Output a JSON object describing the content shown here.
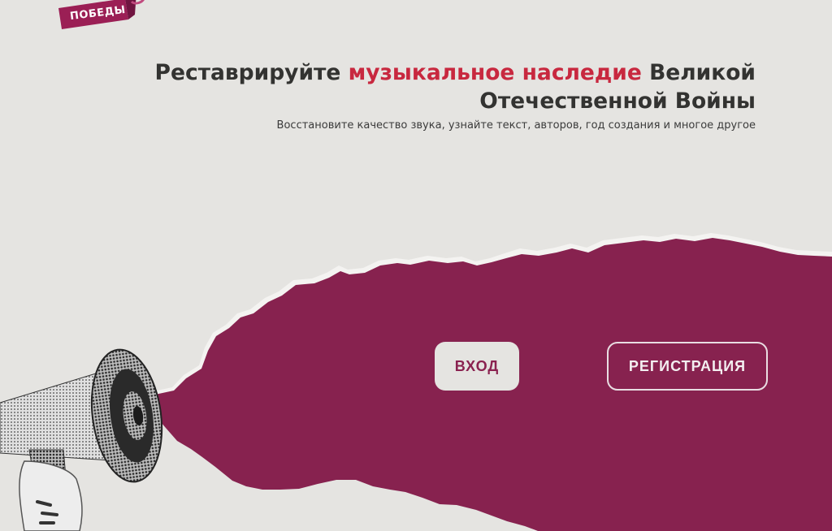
{
  "colors": {
    "background": "#e5e4e1",
    "accent_red": "#c8283f",
    "brand_maroon": "#87224f",
    "heading": "#333331"
  },
  "logo": {
    "text": "ПОБЕДЫ"
  },
  "hero": {
    "title_part1": "Реставрируйте ",
    "title_highlight": "музыкальное наследие",
    "title_part2": " Великой Отечественной Войны",
    "subtitle": "Восстановите качество звука, узнайте текст, авторов, год создания и многое другое"
  },
  "actions": {
    "login_label": "ВХОД",
    "register_label": "РЕГИСТРАЦИЯ"
  },
  "illustration": {
    "icon": "megaphone-icon"
  }
}
